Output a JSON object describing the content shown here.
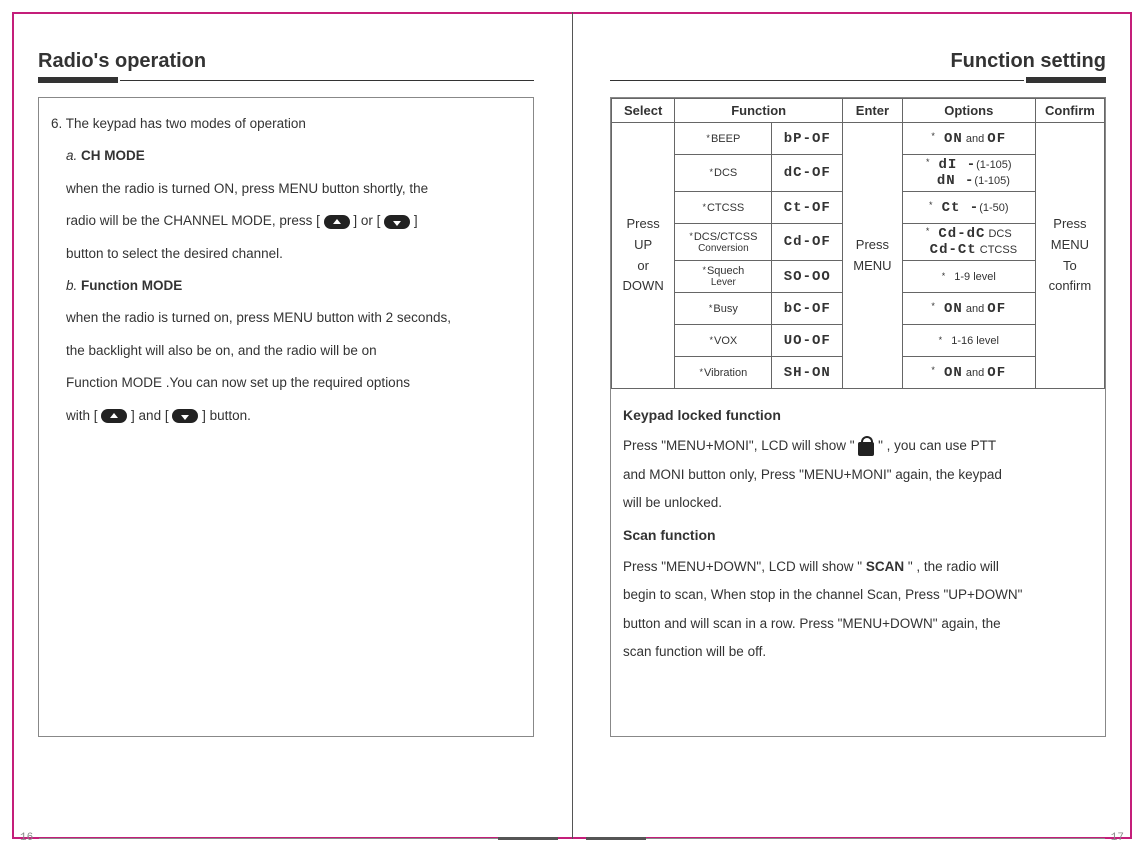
{
  "left": {
    "title": "Radio's operation",
    "line1": "6. The keypad has two modes of operation",
    "modeA_label": "a.",
    "modeA_title": "CH MODE",
    "modeA_p1": "when the radio is turned ON, press MENU button shortly, the",
    "modeA_p2": "radio will be the CHANNEL MODE, press [",
    "modeA_p2b": "] or [",
    "modeA_p2c": "]",
    "modeA_p3": "button to select the desired channel.",
    "modeB_label": "b.",
    "modeB_title": "Function MODE",
    "modeB_p1": "when the radio is turned on, press MENU button with 2 seconds,",
    "modeB_p2": "the backlight will also be on, and the radio will be on",
    "modeB_p3": "Function MODE .You can now set up the required options",
    "modeB_p4a": "with  [",
    "modeB_p4b": "] and [",
    "modeB_p4c": "] button.",
    "pageNum": "16"
  },
  "right": {
    "title": "Function setting",
    "table": {
      "headers": {
        "select": "Select",
        "function": "Function",
        "enter": "Enter",
        "options": "Options",
        "confirm": "Confirm"
      },
      "selectText": [
        "Press",
        "UP",
        "or",
        "DOWN"
      ],
      "enterText": [
        "Press",
        "MENU"
      ],
      "confirmText": [
        "Press",
        "MENU",
        "To",
        "confirm"
      ],
      "rows": [
        {
          "name": "BEEP",
          "seg": "bP-OF",
          "opt_seg1": "ON",
          "opt_mid": "and",
          "opt_seg2": "OF"
        },
        {
          "name": "DCS",
          "seg": "dC-OF",
          "opt_line1_seg": "dI -",
          "opt_line1_txt": "(1-105)",
          "opt_line2_seg": "dN -",
          "opt_line2_txt": "(1-105)"
        },
        {
          "name": "CTCSS",
          "seg": "Ct-OF",
          "opt_seg": "Ct -",
          "opt_txt": "(1-50)"
        },
        {
          "name": "DCS/CTCSS",
          "sub": "Conversion",
          "seg": "Cd-OF",
          "opt_line1_seg": "Cd-dC",
          "opt_line1_txt": "DCS",
          "opt_line2_seg": "Cd-Ct",
          "opt_line2_txt": "CTCSS"
        },
        {
          "name": "Squech",
          "sub": "Lever",
          "seg": "SO-OO",
          "opt_txt": "1-9 level"
        },
        {
          "name": "Busy",
          "seg": "bC-OF",
          "opt_seg1": "ON",
          "opt_mid": "and",
          "opt_seg2": "OF"
        },
        {
          "name": "VOX",
          "seg": "UO-OF",
          "opt_txt": "1-16 level"
        },
        {
          "name": "Vibration",
          "seg": "SH-ON",
          "opt_seg1": "ON",
          "opt_mid": "and",
          "opt_seg2": "OF"
        }
      ]
    },
    "lockedTitle": "Keypad locked function",
    "lockedP1a": "Press \"MENU+MONI\", LCD will show  \"",
    "lockedP1b": "\" , you can use PTT",
    "lockedP2": "and MONI button only, Press \"MENU+MONI\" again, the keypad",
    "lockedP3": "will be unlocked.",
    "scanTitle": "Scan function",
    "scanP1a": "Press \"MENU+DOWN\", LCD will show \"",
    "scanBold": "SCAN",
    "scanP1b": "\" , the radio will",
    "scanP2": "begin to scan, When stop in the channel Scan, Press \"UP+DOWN\"",
    "scanP3": "button and will scan in a row. Press \"MENU+DOWN\" again, the",
    "scanP4": "scan function will be off.",
    "pageNum": "17"
  }
}
